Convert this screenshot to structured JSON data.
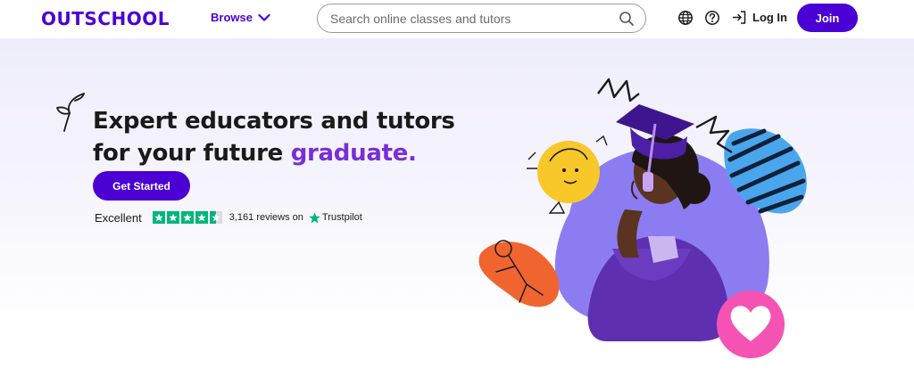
{
  "header": {
    "logo": "OUTSCHOOL",
    "browse_label": "Browse",
    "search_placeholder": "Search online classes and tutors",
    "login_label": "Log In",
    "join_label": "Join"
  },
  "hero": {
    "headline_line1": "Expert educators and tutors",
    "headline_line2_prefix": "for your future ",
    "headline_highlight": "graduate.",
    "cta_label": "Get Started",
    "trustpilot": {
      "rating_word": "Excellent",
      "reviews": "3,161 reviews on",
      "brand": "Trustpilot",
      "stars_filled": 4.5
    }
  },
  "colors": {
    "brand": "#4b01d4",
    "highlight": "#7a2ed6",
    "trustpilot_green": "#00b67a",
    "blob_purple": "#8c7cf2",
    "heart_pink": "#f453b4",
    "yellow_circle": "#f8c72a",
    "orange_doodle": "#f0652f",
    "zebra_blue": "#4aa6ec"
  },
  "icons": [
    "chevron-down-icon",
    "search-icon",
    "globe-icon",
    "help-icon",
    "login-icon",
    "heart-icon",
    "star-icon"
  ]
}
